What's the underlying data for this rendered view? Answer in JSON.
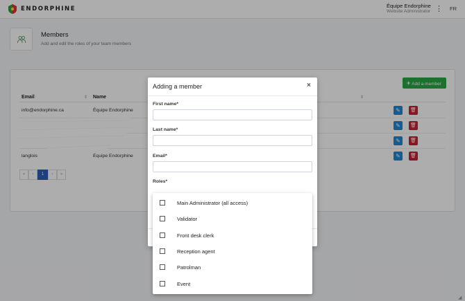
{
  "topbar": {
    "brand": "ENDORPHINE",
    "logo_icon": "endorphine-logo-icon",
    "user_name": "Équipe Endorphine",
    "user_role": "Website Administrator",
    "menu_icon": "more-vertical-icon",
    "language": "FR"
  },
  "page": {
    "icon": "team-icon",
    "title": "Members",
    "subtitle": "Add and edit the roles of your team members"
  },
  "table": {
    "add_button": "Add a member",
    "columns": [
      "Email",
      "Name"
    ],
    "rows": [
      {
        "email": "info@endorphine.ca",
        "name": "Équipe Endorphine"
      },
      {
        "email": "",
        "name": ""
      },
      {
        "email": "",
        "name": ""
      },
      {
        "email": "langlois",
        "name": "Équipe Endorphine"
      }
    ],
    "pagination": {
      "first": "«",
      "prev": "‹",
      "current": "1",
      "next": "›",
      "last": "»"
    }
  },
  "modal": {
    "title": "Adding a member",
    "close": "×",
    "fields": [
      {
        "label": "First name*",
        "value": ""
      },
      {
        "label": "Last name*",
        "value": ""
      },
      {
        "label": "Email*",
        "value": ""
      }
    ],
    "roles_label": "Roles*"
  },
  "roles_options": [
    {
      "label": "Main Administrator (all access)",
      "checked": false
    },
    {
      "label": "Validator",
      "checked": false
    },
    {
      "label": "Front desk clerk",
      "checked": false
    },
    {
      "label": "Reception agent",
      "checked": false
    },
    {
      "label": "Patrolman",
      "checked": false
    },
    {
      "label": "Event",
      "checked": false
    }
  ],
  "colors": {
    "add_button": "#28a745",
    "edit_button": "#1e88d6",
    "delete_button": "#c82333",
    "pager_active": "#2c5fb7"
  }
}
